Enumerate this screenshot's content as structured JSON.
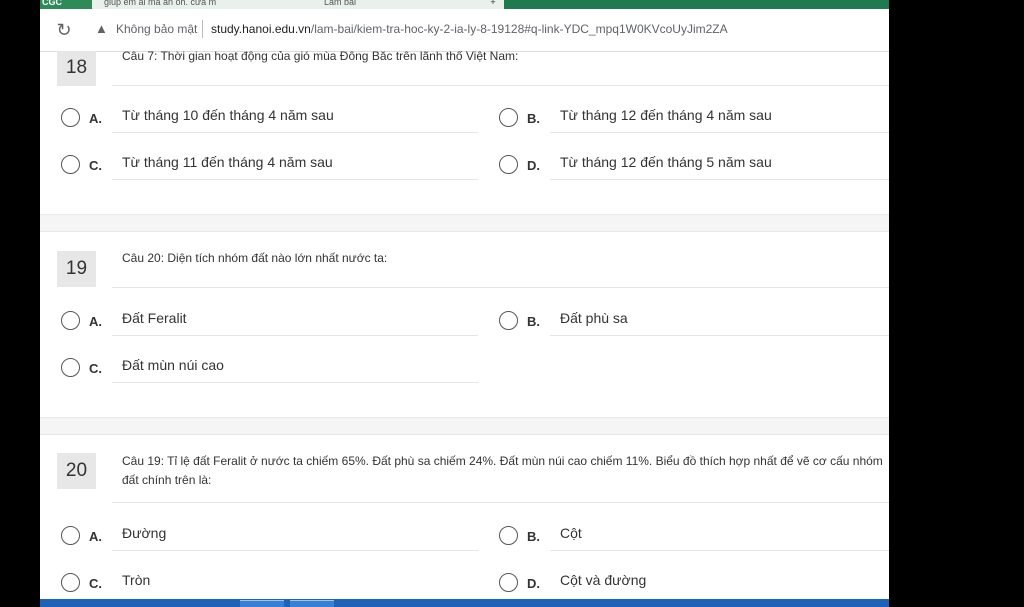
{
  "browser": {
    "tab_logo": "CGC",
    "tab1_title": "giúp em ài mà ăn oh. cửa m",
    "tab2_title": "Làm bài",
    "new_tab": "+",
    "security_label": "Không bảo mật",
    "url_host": "study.hanoi.edu.vn",
    "url_path": "/lam-bai/kiem-tra-hoc-ky-2-ia-ly-8-19128#q-link-YDC_mpq1W0KVcoUyJim2ZA",
    "warn_glyph": "▲",
    "reload_glyph": "↻"
  },
  "questions": [
    {
      "number": "18",
      "text": "Câu 7: Thời gian hoạt động của gió mùa Đông Bắc trên lãnh thổ Việt Nam:",
      "options": [
        {
          "letter": "A.",
          "text": "Từ tháng 10 đến tháng 4 năm sau"
        },
        {
          "letter": "B.",
          "text": "Từ tháng 12 đến tháng 4 năm sau"
        },
        {
          "letter": "C.",
          "text": "Từ tháng 11 đến tháng 4 năm sau"
        },
        {
          "letter": "D.",
          "text": "Từ tháng 12 đến tháng 5 năm sau"
        }
      ]
    },
    {
      "number": "19",
      "text": "Câu 20: Diện tích nhóm đất nào lớn nhất nước ta:",
      "options": [
        {
          "letter": "A.",
          "text": "Đất Feralit"
        },
        {
          "letter": "B.",
          "text": "Đất phù sa"
        },
        {
          "letter": "C.",
          "text": "Đất mùn núi cao"
        }
      ]
    },
    {
      "number": "20",
      "text": "Câu 19: Tỉ lệ đất Feralit ở nước ta chiếm 65%. Đất phù sa chiếm 24%. Đất mùn núi cao chiếm 11%. Biểu đồ thích hợp nhất để vẽ cơ cấu nhóm đất chính trên là:",
      "options": [
        {
          "letter": "A.",
          "text": "Đường"
        },
        {
          "letter": "B.",
          "text": "Cột"
        },
        {
          "letter": "C.",
          "text": "Tròn"
        },
        {
          "letter": "D.",
          "text": "Cột và đường"
        }
      ]
    }
  ]
}
